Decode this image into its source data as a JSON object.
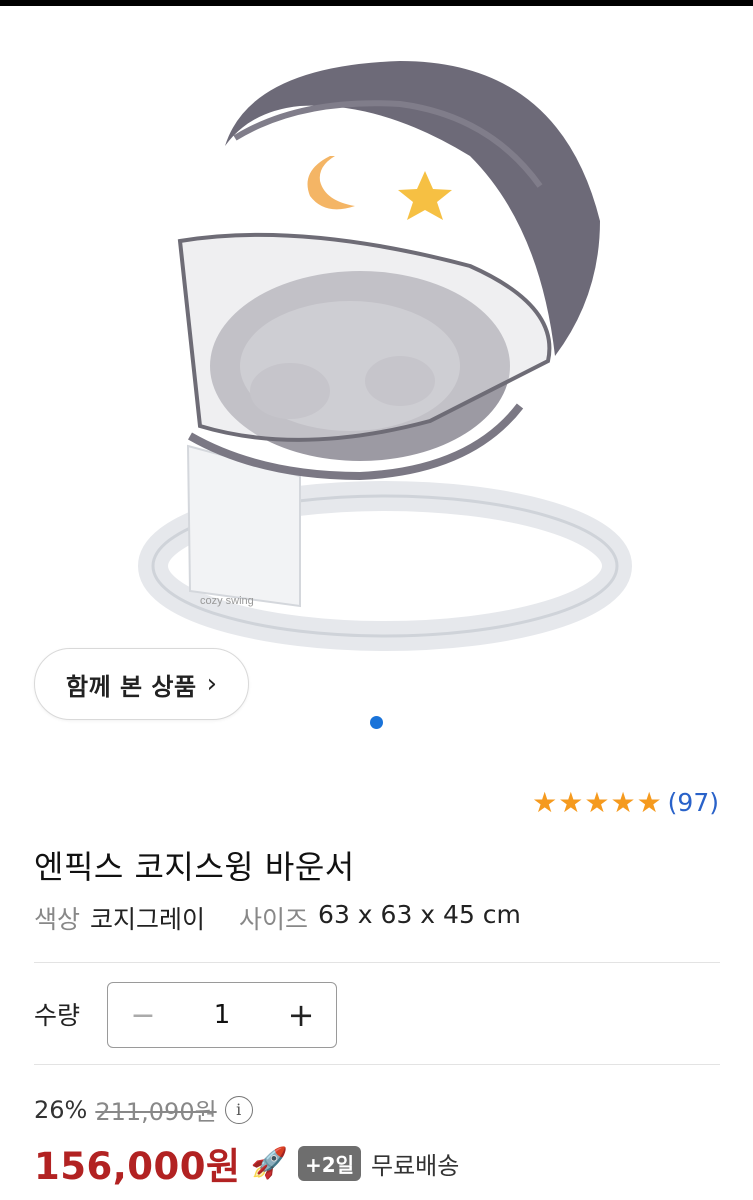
{
  "product": {
    "image_alt": "bouncer-with-canopy",
    "brand_print": "cozy swing",
    "related_button_label": "함께 본 상품",
    "rating": {
      "stars": 5,
      "review_count": "(97)"
    },
    "title": "엔픽스 코지스윙 바운서",
    "options": {
      "color_key": "색상",
      "color_value": "코지그레이",
      "size_key": "사이즈",
      "size_value": "63 x 63 x 45 cm"
    },
    "quantity": {
      "label": "수량",
      "value": "1",
      "minus": "−",
      "plus": "+"
    },
    "pricing": {
      "discount": "26%",
      "original": "211,090원",
      "info": "i",
      "sale": "156,000원",
      "delivery_badge": "+2일",
      "shipping": "무료배송"
    }
  },
  "icons": {
    "chevron": "chevron-right-icon",
    "star": "star-icon",
    "rocket": "rocket-icon",
    "info": "info-icon"
  },
  "colors": {
    "accent_blue": "#1a73d9",
    "star": "#f59a1e",
    "price_red": "#b22222"
  }
}
